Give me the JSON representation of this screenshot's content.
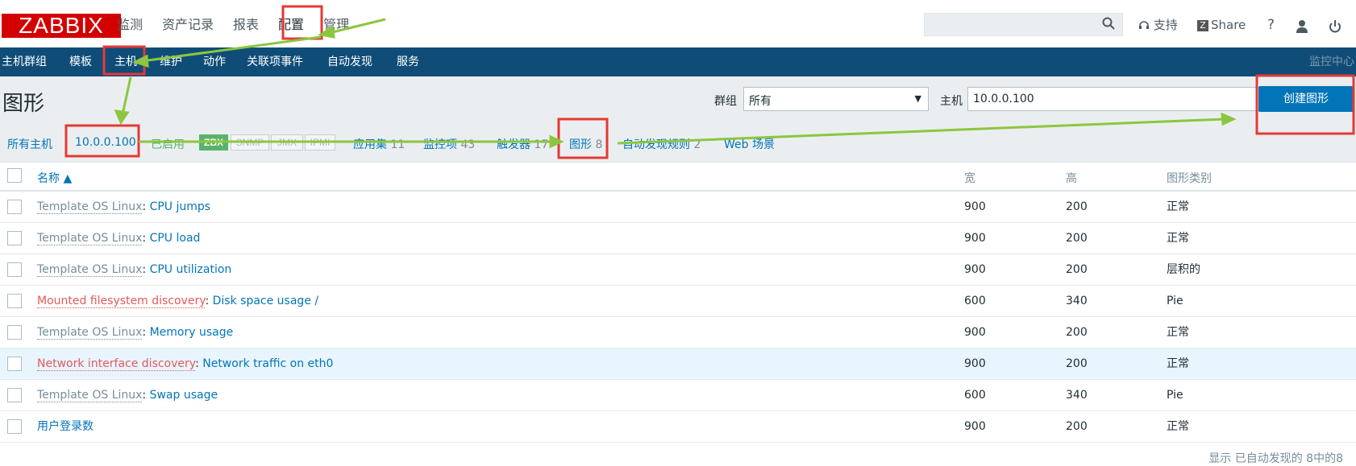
{
  "header": {
    "logo": "ZABBIX",
    "menu": [
      "监测",
      "资产记录",
      "报表",
      "配置",
      "管理"
    ],
    "search_placeholder": "",
    "support": "支持",
    "share": "Share",
    "help": "?"
  },
  "nav": {
    "items": [
      "主机群组",
      "模板",
      "主机",
      "维护",
      "动作",
      "关联项事件",
      "自动发现",
      "服务"
    ],
    "right": "监控中心"
  },
  "page": {
    "title": "图形",
    "group_label": "群组",
    "group_value": "所有",
    "host_label": "主机",
    "host_value": "10.0.0.100",
    "create_button": "创建图形"
  },
  "subtabs": {
    "all_hosts": "所有主机",
    "host": "10.0.0.100",
    "enabled": "已启用",
    "zbx": "ZBX",
    "snmp": "SNMP",
    "jmx": "JMX",
    "ipmi": "IPMI",
    "applications": "应用集",
    "applications_count": "11",
    "items": "监控项",
    "items_count": "43",
    "triggers": "触发器",
    "triggers_count": "17",
    "graphs": "图形",
    "graphs_count": "8",
    "discovery": "自动发现规则",
    "discovery_count": "2",
    "web": "Web 场景"
  },
  "table": {
    "headers": {
      "name": "名称 ▲",
      "width": "宽",
      "height": "高",
      "type": "图形类别"
    },
    "rows": [
      {
        "prefix": "Template OS Linux",
        "prefix_kind": "template",
        "name": "CPU jumps",
        "width": "900",
        "height": "200",
        "type": "正常"
      },
      {
        "prefix": "Template OS Linux",
        "prefix_kind": "template",
        "name": "CPU load",
        "width": "900",
        "height": "200",
        "type": "正常"
      },
      {
        "prefix": "Template OS Linux",
        "prefix_kind": "template",
        "name": "CPU utilization",
        "width": "900",
        "height": "200",
        "type": "层积的"
      },
      {
        "prefix": "Mounted filesystem discovery",
        "prefix_kind": "discovery",
        "name": "Disk space usage /",
        "width": "600",
        "height": "340",
        "type": "Pie"
      },
      {
        "prefix": "Template OS Linux",
        "prefix_kind": "template",
        "name": "Memory usage",
        "width": "900",
        "height": "200",
        "type": "正常"
      },
      {
        "prefix": "Network interface discovery",
        "prefix_kind": "discovery",
        "name": "Network traffic on eth0",
        "width": "900",
        "height": "200",
        "type": "正常"
      },
      {
        "prefix": "Template OS Linux",
        "prefix_kind": "template",
        "name": "Swap usage",
        "width": "600",
        "height": "340",
        "type": "Pie"
      },
      {
        "prefix": "",
        "prefix_kind": "none",
        "name": "用户登录数",
        "width": "900",
        "height": "200",
        "type": "正常"
      }
    ],
    "footer": "显示 已自动发现的 8中的8"
  },
  "colors": {
    "brand": "#d40000",
    "nav_bg": "#0f4d78",
    "link": "#0275b8",
    "annotation_box": "#e53935",
    "annotation_arrow": "#8cc63f"
  }
}
